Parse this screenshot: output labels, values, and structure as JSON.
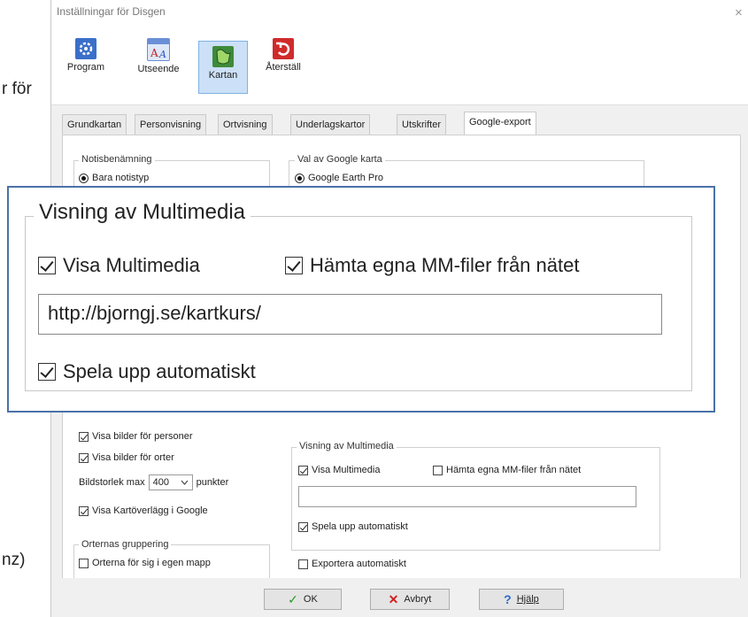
{
  "background": {
    "text_top": "r för",
    "text_bottom": "nz)"
  },
  "window": {
    "title": "Inställningar för Disgen",
    "close": "×"
  },
  "toolbar": {
    "buttons": [
      {
        "label": "Program",
        "icon": "gear-icon",
        "color": "#3b6fc9"
      },
      {
        "label": "Utseende",
        "icon": "font-icon",
        "color": "#6a8fd6"
      },
      {
        "label": "Kartan",
        "icon": "map-icon",
        "color": "#3f8a3a"
      },
      {
        "label": "Återställ",
        "icon": "undo-icon",
        "color": "#d02b2b"
      }
    ]
  },
  "tabs": [
    "Grundkartan",
    "Personvisning",
    "Ortvisning",
    "Underlagskartor",
    "Utskrifter",
    "Google-export"
  ],
  "active_tab": "Google-export",
  "notis": {
    "legend": "Notisbenämning",
    "option": "Bara notistyp"
  },
  "google_karta": {
    "legend": "Val av Google karta",
    "option": "Google Earth Pro"
  },
  "bilder": {
    "personer": "Visa bilder för personer",
    "orter": "Visa bilder för orter",
    "size_label": "Bildstorlek max",
    "size_value": "400",
    "size_unit": "punkter",
    "overlay": "Visa Kartöverlägg i Google"
  },
  "grouping": {
    "legend": "Orternas gruppering",
    "option": "Orterna för sig i egen mapp"
  },
  "multimedia": {
    "legend": "Visning av  Multimedia",
    "show": "Visa Multimedia",
    "fetch": "Hämta egna MM-filer från nätet",
    "url": "",
    "autoplay": "Spela upp  automatiskt"
  },
  "export_auto": "Exportera automatiskt",
  "buttons": {
    "ok": "OK",
    "cancel": "Avbryt",
    "help": "Hjälp"
  },
  "zoom": {
    "legend": "Visning av  Multimedia",
    "show": "Visa Multimedia",
    "fetch": "Hämta egna MM-filer från nätet",
    "url": "http://bjorngj.se/kartkurs/",
    "autoplay": "Spela upp  automatiskt"
  }
}
